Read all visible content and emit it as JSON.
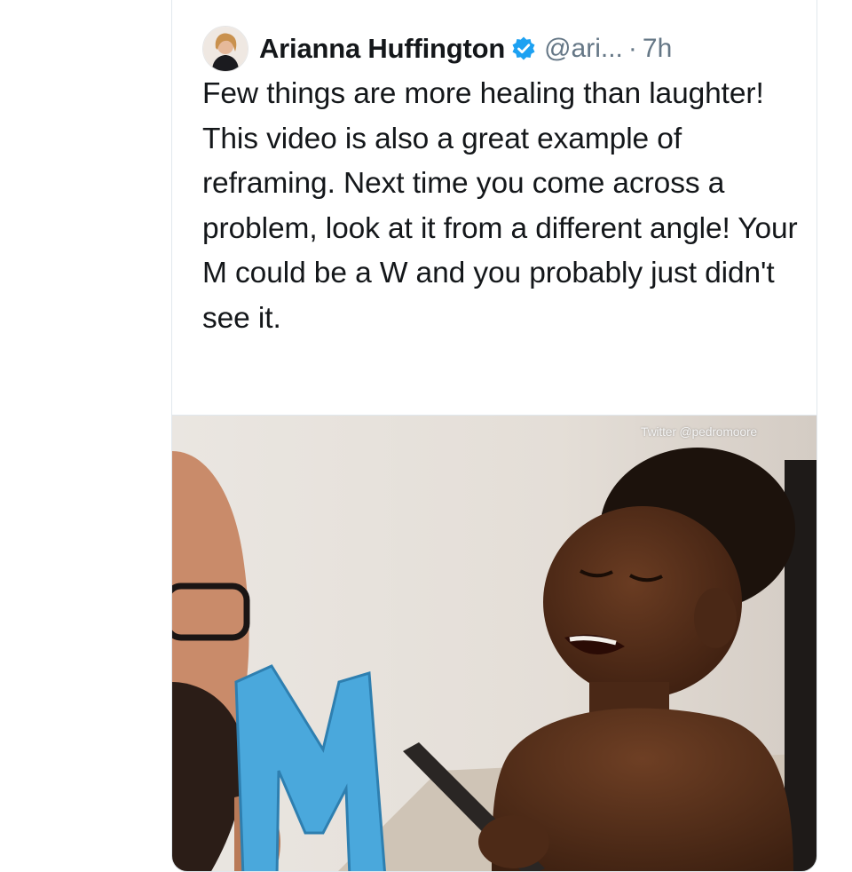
{
  "tweet": {
    "author_name": "Arianna Huffington",
    "handle": "@ari...",
    "separator": "·",
    "time": "7h",
    "verified": true,
    "text": "Few things are more healing than laughter! This video is also a great example of reframing. Next time you come across a problem, look at it from a different angle! Your M could be a W and you probably just didn't see it."
  },
  "media": {
    "type": "video",
    "watermark": "Twitter @pedromoore",
    "letter_shown": "M"
  },
  "icons": {
    "avatar": "profile-avatar",
    "verified": "verified-badge-icon"
  },
  "colors": {
    "verified_blue": "#1da1f2",
    "text_primary": "#14171a",
    "text_secondary": "#657786",
    "letter_blue": "#4aa8dc"
  }
}
